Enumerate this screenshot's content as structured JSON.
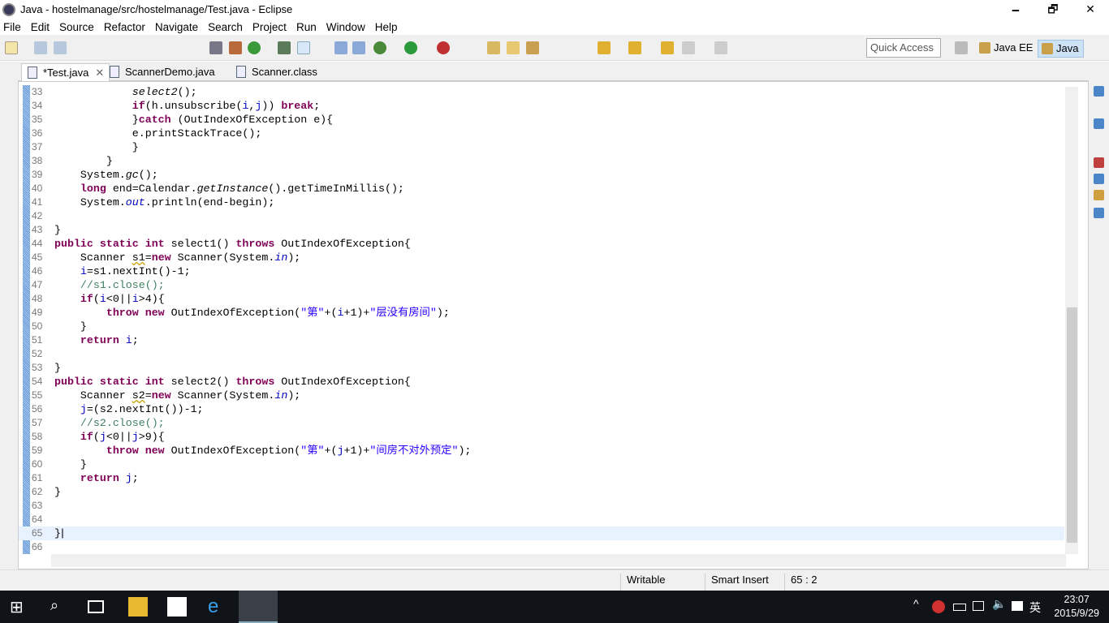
{
  "window": {
    "title": "Java - hostelmanage/src/hostelmanage/Test.java - Eclipse",
    "minimize": "🗕",
    "restore": "🗗",
    "close": "✕"
  },
  "menu": [
    "File",
    "Edit",
    "Source",
    "Refactor",
    "Navigate",
    "Search",
    "Project",
    "Run",
    "Window",
    "Help"
  ],
  "toolbar": {
    "quick_access_placeholder": "Quick Access",
    "perspectives": [
      {
        "label": "Java EE",
        "active": false
      },
      {
        "label": "Java",
        "active": true
      }
    ]
  },
  "tabs": [
    {
      "label": "*Test.java",
      "active": true,
      "close": "✕"
    },
    {
      "label": "ScannerDemo.java",
      "active": false
    },
    {
      "label": "Scanner.class",
      "active": false
    }
  ],
  "editor": {
    "current_line": 65,
    "lines": [
      {
        "n": 33,
        "s": [
          [
            "            ",
            ""
          ],
          [
            "select2",
            "i"
          ],
          [
            "();",
            ""
          ]
        ]
      },
      {
        "n": 34,
        "s": [
          [
            "            ",
            ""
          ],
          [
            "if",
            "k"
          ],
          [
            "(h.unsubscribe(",
            ""
          ],
          [
            "i",
            "fi"
          ],
          [
            ",",
            ""
          ],
          [
            "j",
            "fi"
          ],
          [
            ")) ",
            ""
          ],
          [
            "break",
            "k"
          ],
          [
            ";",
            ""
          ]
        ]
      },
      {
        "n": 35,
        "s": [
          [
            "            }",
            ""
          ],
          [
            "catch",
            "k"
          ],
          [
            " (OutIndexOfException e){",
            ""
          ]
        ]
      },
      {
        "n": 36,
        "s": [
          [
            "            e.printStackTrace();",
            ""
          ]
        ]
      },
      {
        "n": 37,
        "s": [
          [
            "            }",
            ""
          ]
        ]
      },
      {
        "n": 38,
        "s": [
          [
            "        }",
            ""
          ]
        ]
      },
      {
        "n": 39,
        "s": [
          [
            "    System.",
            ""
          ],
          [
            "gc",
            "i"
          ],
          [
            "();",
            ""
          ]
        ]
      },
      {
        "n": 40,
        "s": [
          [
            "    ",
            ""
          ],
          [
            "long",
            "k"
          ],
          [
            " end=Calendar.",
            ""
          ],
          [
            "getInstance",
            "i"
          ],
          [
            "().getTimeInMillis();",
            ""
          ]
        ]
      },
      {
        "n": 41,
        "s": [
          [
            "    System.",
            ""
          ],
          [
            "out",
            "f"
          ],
          [
            ".println(end-begin);",
            ""
          ]
        ]
      },
      {
        "n": 42,
        "s": []
      },
      {
        "n": 43,
        "s": [
          [
            "}",
            ""
          ]
        ]
      },
      {
        "n": 44,
        "s": [
          [
            "public static int",
            "k"
          ],
          [
            " select1() ",
            ""
          ],
          [
            "throws",
            "k"
          ],
          [
            " OutIndexOfException{",
            ""
          ]
        ]
      },
      {
        "n": 45,
        "s": [
          [
            "    Scanner ",
            ""
          ],
          [
            "s1",
            "w"
          ],
          [
            "=",
            ""
          ],
          [
            "new",
            "k"
          ],
          [
            " Scanner(System.",
            ""
          ],
          [
            "in",
            "f"
          ],
          [
            ");",
            ""
          ]
        ]
      },
      {
        "n": 46,
        "s": [
          [
            "    ",
            ""
          ],
          [
            "i",
            "fi"
          ],
          [
            "=s1.nextInt()-1;",
            ""
          ]
        ]
      },
      {
        "n": 47,
        "s": [
          [
            "    //s1.close();",
            "c"
          ]
        ]
      },
      {
        "n": 48,
        "s": [
          [
            "    ",
            ""
          ],
          [
            "if",
            "k"
          ],
          [
            "(",
            ""
          ],
          [
            "i",
            "fi"
          ],
          [
            "<0||",
            ""
          ],
          [
            "i",
            "fi"
          ],
          [
            ">4){",
            ""
          ]
        ]
      },
      {
        "n": 49,
        "s": [
          [
            "        ",
            ""
          ],
          [
            "throw new",
            "k"
          ],
          [
            " OutIndexOfException(",
            ""
          ],
          [
            "\"第\"",
            "s"
          ],
          [
            "+(",
            ""
          ],
          [
            "i",
            "fi"
          ],
          [
            "+1)+",
            ""
          ],
          [
            "\"层没有房间\"",
            "s"
          ],
          [
            ");",
            ""
          ]
        ]
      },
      {
        "n": 50,
        "s": [
          [
            "    }",
            ""
          ]
        ]
      },
      {
        "n": 51,
        "s": [
          [
            "    ",
            ""
          ],
          [
            "return",
            "k"
          ],
          [
            " ",
            ""
          ],
          [
            "i",
            "fi"
          ],
          [
            ";",
            ""
          ]
        ]
      },
      {
        "n": 52,
        "s": []
      },
      {
        "n": 53,
        "s": [
          [
            "}",
            ""
          ]
        ]
      },
      {
        "n": 54,
        "s": [
          [
            "public static int",
            "k"
          ],
          [
            " select2() ",
            ""
          ],
          [
            "throws",
            "k"
          ],
          [
            " OutIndexOfException{",
            ""
          ]
        ]
      },
      {
        "n": 55,
        "s": [
          [
            "    Scanner ",
            ""
          ],
          [
            "s2",
            "w"
          ],
          [
            "=",
            ""
          ],
          [
            "new",
            "k"
          ],
          [
            " Scanner(System.",
            ""
          ],
          [
            "in",
            "f"
          ],
          [
            ");",
            ""
          ]
        ]
      },
      {
        "n": 56,
        "s": [
          [
            "    ",
            ""
          ],
          [
            "j",
            "fi"
          ],
          [
            "=(s2.nextInt())-1;",
            ""
          ]
        ]
      },
      {
        "n": 57,
        "s": [
          [
            "    //s2.close();",
            "c"
          ]
        ]
      },
      {
        "n": 58,
        "s": [
          [
            "    ",
            ""
          ],
          [
            "if",
            "k"
          ],
          [
            "(",
            ""
          ],
          [
            "j",
            "fi"
          ],
          [
            "<0||",
            ""
          ],
          [
            "j",
            "fi"
          ],
          [
            ">9){",
            ""
          ]
        ]
      },
      {
        "n": 59,
        "s": [
          [
            "        ",
            ""
          ],
          [
            "throw new",
            "k"
          ],
          [
            " OutIndexOfException(",
            ""
          ],
          [
            "\"第\"",
            "s"
          ],
          [
            "+(",
            ""
          ],
          [
            "j",
            "fi"
          ],
          [
            "+1)+",
            ""
          ],
          [
            "\"间房不对外预定\"",
            "s"
          ],
          [
            ");",
            ""
          ]
        ]
      },
      {
        "n": 60,
        "s": [
          [
            "    }",
            ""
          ]
        ]
      },
      {
        "n": 61,
        "s": [
          [
            "    ",
            ""
          ],
          [
            "return",
            "k"
          ],
          [
            " ",
            ""
          ],
          [
            "j",
            "fi"
          ],
          [
            ";",
            ""
          ]
        ]
      },
      {
        "n": 62,
        "s": [
          [
            "}",
            ""
          ]
        ]
      },
      {
        "n": 63,
        "s": []
      },
      {
        "n": 64,
        "s": []
      },
      {
        "n": 65,
        "s": [
          [
            "}",
            ""
          ]
        ]
      },
      {
        "n": 66,
        "s": []
      }
    ]
  },
  "status": {
    "writable": "Writable",
    "insert_mode": "Smart Insert",
    "position": "65 : 2"
  },
  "taskbar": {
    "time": "23:07",
    "date": "2015/9/29",
    "ime": "英",
    "tray_up": "^"
  }
}
